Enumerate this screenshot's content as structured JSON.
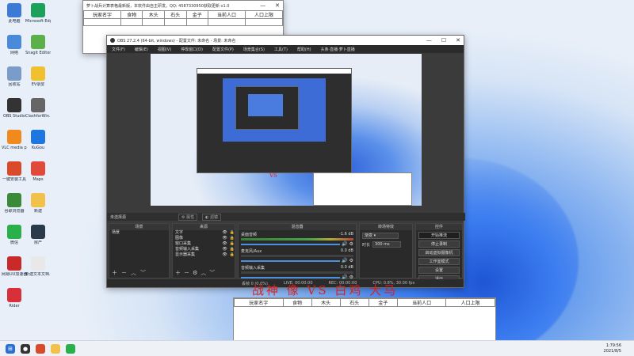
{
  "desktop": {
    "icons": [
      {
        "label": "此电脑",
        "color": "#3d7ad6"
      },
      {
        "label": "Microsoft Edge",
        "color": "#1da05a"
      },
      {
        "label": "网络",
        "color": "#4a8ad8"
      },
      {
        "label": "Snagit Editor",
        "color": "#5bb04a"
      },
      {
        "label": "回收站",
        "color": "#7a9cc8"
      },
      {
        "label": "EV录屏",
        "color": "#f0c030"
      },
      {
        "label": "OBS Studio",
        "color": "#333333"
      },
      {
        "label": "ClashforWin...",
        "color": "#666666"
      },
      {
        "label": "VLC media player",
        "color": "#f08a1c"
      },
      {
        "label": "KuGou",
        "color": "#1e76e0"
      },
      {
        "label": "一键安装工具",
        "color": "#d84a2a"
      },
      {
        "label": "Maps",
        "color": "#e14a3a"
      },
      {
        "label": "谷歌浏览器",
        "color": "#3a8a3a"
      },
      {
        "label": "新建",
        "color": "#f2c14a"
      },
      {
        "label": "微信",
        "color": "#2ab04a"
      },
      {
        "label": "房产",
        "color": "#2a3a4a"
      },
      {
        "label": "网易UU加速器",
        "color": "#c82a2a"
      },
      {
        "label": "新建文本文档.txt",
        "color": "#e8e8e8"
      },
      {
        "label": "Rider",
        "color": "#d8303a"
      }
    ]
  },
  "table_window": {
    "title": "萝卜战兵计算表格最新版，本软件由自主研发。QQ: 4587330950获取更新 v1.0",
    "headers": [
      "玩家名字",
      "食物",
      "木头",
      "石头",
      "金子",
      "当前人口",
      "人口上限"
    ],
    "rows": []
  },
  "obs": {
    "title": "OBS 27.2.4 (64-bit, windows) - 配置文件: 未命名 - 场景: 未命名",
    "menu": [
      "文件(F)",
      "编辑(E)",
      "视图(V)",
      "停靠窗口(D)",
      "配置文件(P)",
      "场景集合(S)",
      "工具(T)",
      "帮助(H)",
      "头条·直播·萝卜直播"
    ],
    "source_label": "未选择源",
    "props_button": "属性",
    "filters_button": "滤镜",
    "scenes": {
      "header": "场景",
      "items": [
        "场景"
      ]
    },
    "sources": {
      "header": "来源",
      "items": [
        "文字",
        "图像",
        "窗口采集",
        "音频输入采集",
        "显示器采集"
      ]
    },
    "mixer": {
      "header": "混音器",
      "channels": [
        {
          "name": "桌面音频",
          "level": "-1.6 dB"
        },
        {
          "name": "麦克风/Aux",
          "level": "0.0 dB"
        },
        {
          "name": "音频输入采集",
          "level": "0.0 dB"
        }
      ]
    },
    "transitions": {
      "header": "转场特效",
      "type": "渐变",
      "duration_label": "时长",
      "duration": "300 ms"
    },
    "controls": {
      "header": "控件",
      "buttons": [
        "开始推流",
        "停止录制",
        "启动虚拟摄像机",
        "工作室模式",
        "设置",
        "退出"
      ]
    },
    "status": {
      "drop": "丢帧 0 (0.0%)",
      "live": "LIVE: 00:00:00",
      "rec": "REC: 00:00:00",
      "cpu": "CPU: 0.8%, 30.00 fps"
    }
  },
  "overlay": {
    "line1": "战神 像 VS 白鸡 大马",
    "line2": "玩家名字 食物 木头 石头 金子 当前人口 人口上限"
  },
  "taskbar": {
    "time": "1:79:56",
    "date": "2021/8/5"
  }
}
